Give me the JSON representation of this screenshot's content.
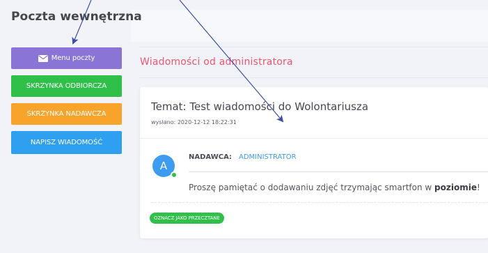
{
  "page": {
    "title": "Poczta wewnętrzna"
  },
  "menu": {
    "header_label": "Menu poczty",
    "items": [
      {
        "label": "SKRZYNKA ODBIORCZA",
        "color": "#2fc04a"
      },
      {
        "label": "SKRZYNKA NADAWCZA",
        "color": "#f8a42b"
      },
      {
        "label": "NAPISZ WIADOMOŚĆ",
        "color": "#2f9fef"
      }
    ],
    "header_color": "#8a74d6",
    "header_icon": "envelope-icon"
  },
  "section": {
    "title": "Wiadomości od administratora",
    "title_color": "#f0566e"
  },
  "message": {
    "subject": "Temat: Test wiadomości do Wolontariusza",
    "sent": "wysłano: 2020-12-12 18:22:31",
    "avatar_letter": "A",
    "sender_label": "NADAWCA:",
    "sender_name": "ADMINISTRATOR",
    "body_prefix": "Proszę pamiętać o dodawaniu zdjęć trzymając smartfon w ",
    "body_bold": "poziomie",
    "body_suffix": "!",
    "mark_read_label": "OZNACZ JAKO PRZECZTANE"
  }
}
